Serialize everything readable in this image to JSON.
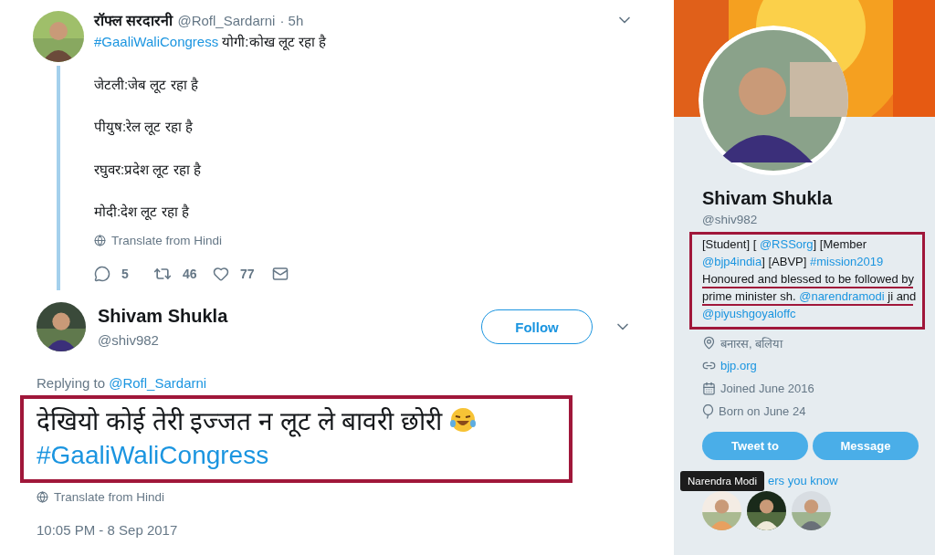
{
  "thread_tweet": {
    "author_name": "रॉफ्ल सरदारनी",
    "handle": "@Rofl_Sardarni",
    "time": "· 5h",
    "lines": [
      [
        {
          "kind": "hashtag",
          "text": "#GaaliWaliCongress"
        },
        {
          "kind": "text",
          "text": " योगी:कोख लूट रहा है"
        }
      ],
      [
        {
          "kind": "text",
          "text": "जेटली:जेब लूट रहा है"
        }
      ],
      [
        {
          "kind": "text",
          "text": "पीयुष:रेल लूट रहा है"
        }
      ],
      [
        {
          "kind": "text",
          "text": "रघुवर:प्रदेश लूट रहा है"
        }
      ],
      [
        {
          "kind": "text",
          "text": "मोदी:देश लूट रहा है"
        }
      ]
    ],
    "translate": "Translate from Hindi",
    "actions": [
      {
        "kind": "reply",
        "count": "5"
      },
      {
        "kind": "retweet",
        "count": "46"
      },
      {
        "kind": "like",
        "count": "77"
      },
      {
        "kind": "message"
      }
    ]
  },
  "reply_tweet": {
    "author_name": "Shivam Shukla",
    "handle": "@shiv982",
    "follow_label": "Follow",
    "replying_prefix": "Replying to",
    "replying_handle": "@Rofl_Sardarni",
    "text": "देखियो कोई तेरी इज्जत न लूट ले बावरी छोरी",
    "hashtag": "#GaaliWaliCongress",
    "highlighted": true,
    "translate": "Translate from Hindi",
    "timestamp": "10:05 PM - 8 Sep 2017"
  },
  "profile": {
    "name": "Shivam Shukla",
    "handle": "@shiv982",
    "bio": {
      "highlighted": true,
      "lines": [
        {
          "underlined": false,
          "segments": [
            {
              "kind": "text",
              "text": "[Student] [ "
            },
            {
              "kind": "link",
              "text": "@RSSorg"
            },
            {
              "kind": "text",
              "text": "] [Member"
            }
          ]
        },
        {
          "underlined": false,
          "segments": [
            {
              "kind": "link",
              "text": "@bjp4india"
            },
            {
              "kind": "text",
              "text": "] [ABVP] "
            },
            {
              "kind": "link",
              "text": "#mission2019"
            }
          ]
        },
        {
          "underlined": true,
          "segments": [
            {
              "kind": "text",
              "text": "Honoured and blessed to be followed by"
            }
          ]
        },
        {
          "underlined": true,
          "segments": [
            {
              "kind": "text",
              "text": "prime minister sh. "
            },
            {
              "kind": "link",
              "text": "@narendramodi"
            },
            {
              "kind": "text",
              "text": " ji and"
            }
          ]
        },
        {
          "underlined": false,
          "segments": [
            {
              "kind": "link",
              "text": "@piyushgoyaloffc"
            }
          ]
        }
      ]
    },
    "details": [
      {
        "kind": "location",
        "text": "बनारस, बलिया"
      },
      {
        "kind": "website",
        "text": "bjp.org"
      },
      {
        "kind": "joined",
        "text": "Joined June 2016"
      },
      {
        "kind": "birthday",
        "text": "Born on June 24"
      }
    ],
    "buttons": [
      "Tweet to",
      "Message"
    ],
    "followers_label": "ers you know",
    "tooltip": "Narendra Modi",
    "followers": [
      {
        "kind": "picture"
      },
      {
        "kind": "picture"
      },
      {
        "kind": "picture"
      }
    ]
  }
}
